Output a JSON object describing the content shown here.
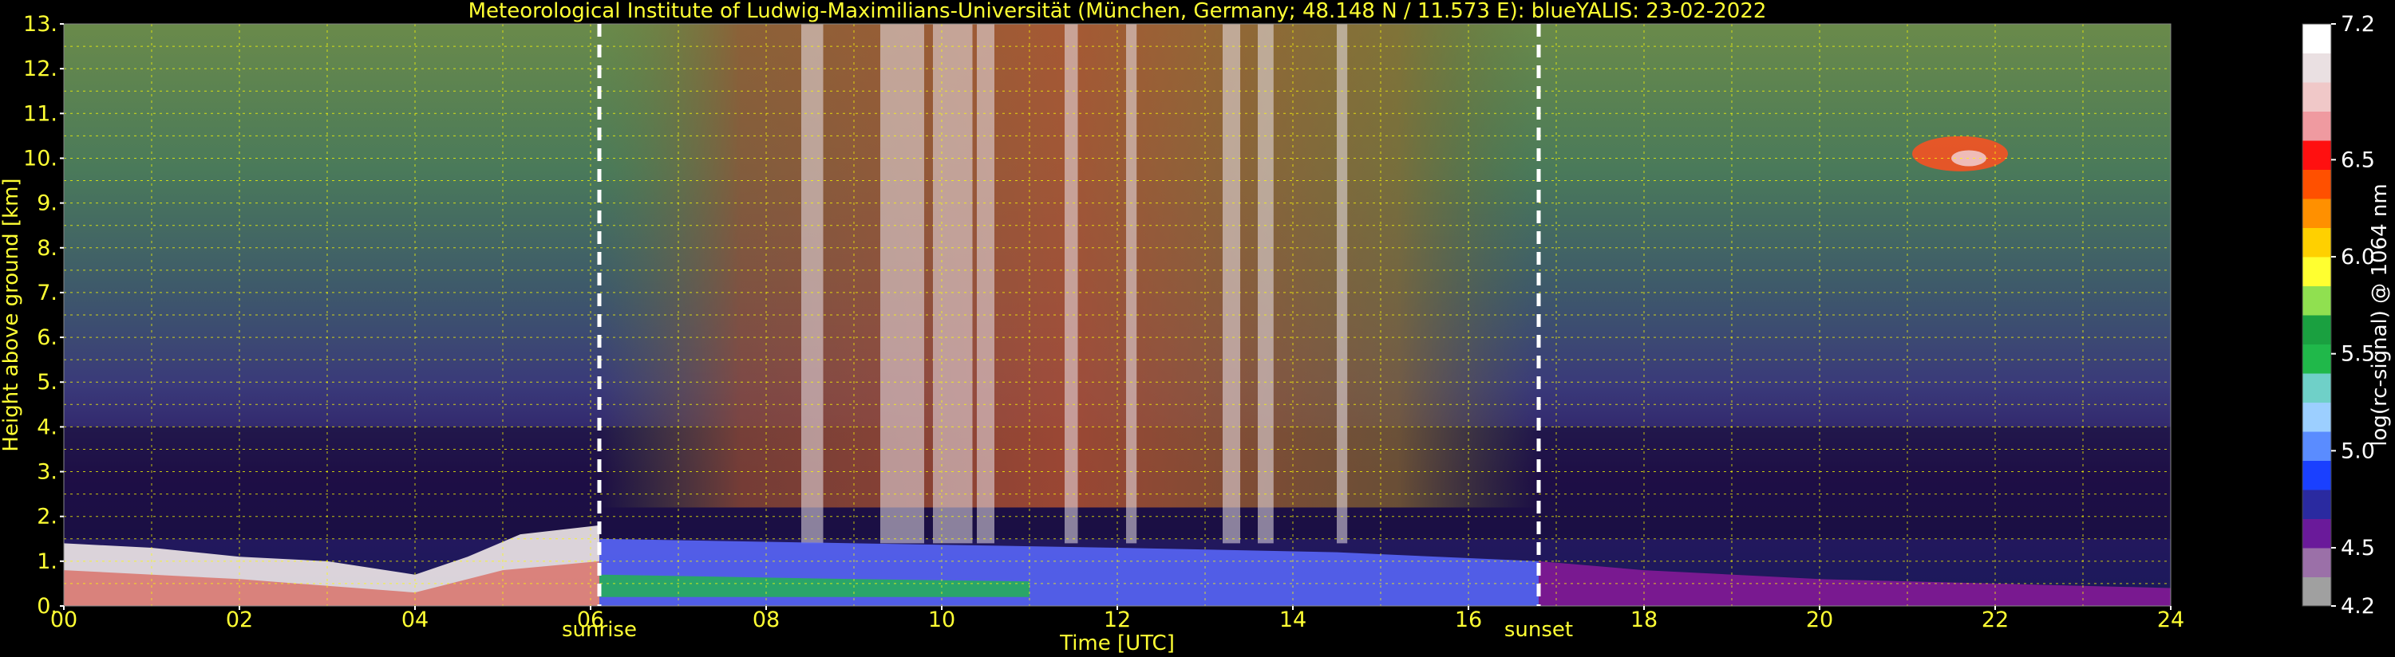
{
  "chart_data": {
    "type": "heatmap",
    "title": "Meteorological Institute of Ludwig-Maximilians-Universität (München, Germany; 48.148 N / 11.573 E):     blueYALIS: 23-02-2022",
    "xlabel": "Time [UTC]",
    "ylabel": "Height above ground [km]",
    "xlim": [
      0,
      24
    ],
    "ylim": [
      0,
      13
    ],
    "x_ticks": [
      "00",
      "02",
      "04",
      "06",
      "08",
      "10",
      "12",
      "14",
      "16",
      "18",
      "20",
      "22",
      "24"
    ],
    "y_ticks": [
      "0.",
      "1.",
      "2.",
      "3.",
      "4.",
      "5.",
      "6.",
      "7.",
      "8.",
      "9.",
      "10.",
      "11.",
      "12.",
      "13."
    ],
    "grid": true,
    "markers": [
      {
        "label": "sunrise",
        "x": 6.1
      },
      {
        "label": "sunset",
        "x": 16.8
      }
    ],
    "colorbar": {
      "label": "log(rc-signal) @ 1064 nm",
      "range": [
        4.2,
        7.2
      ],
      "tick_labels": [
        "4.2",
        "4.5",
        "5.0",
        "5.5",
        "6.0",
        "6.5",
        "7.2"
      ],
      "tick_values": [
        4.2,
        4.5,
        5.0,
        5.5,
        6.0,
        6.5,
        7.2
      ]
    },
    "colors": {
      "background": "#000000",
      "text": "#ffff33",
      "grid": "#ffff00",
      "colorbar_scale": [
        "#a0a0a0",
        "#9b70a8",
        "#6a1a9a",
        "#2a2aa0",
        "#1a40ff",
        "#5a8cff",
        "#9ccfff",
        "#6fd0c8",
        "#20b84a",
        "#1aa040",
        "#90e050",
        "#ffff30",
        "#ffd000",
        "#ff9000",
        "#ff5000",
        "#ff1010",
        "#ef9aa0",
        "#f0c8c8",
        "#eae0e2",
        "#ffffff"
      ]
    }
  }
}
